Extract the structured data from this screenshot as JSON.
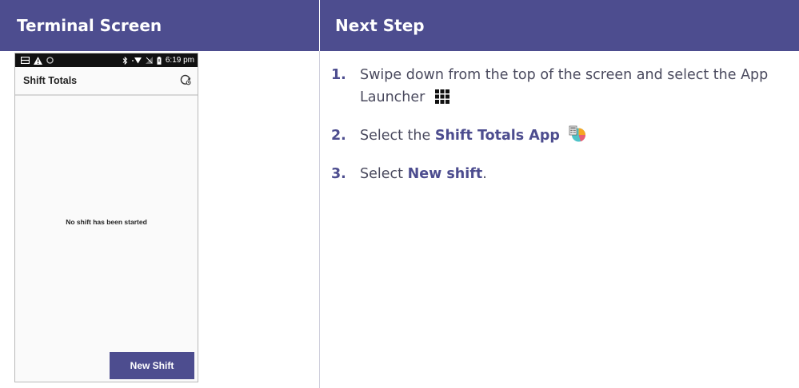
{
  "headers": {
    "left": "Terminal Screen",
    "right": "Next Step"
  },
  "terminal": {
    "status_time": "6:19 pm",
    "app_title": "Shift Totals",
    "empty_message": "No shift has been started",
    "button_label": "New Shift",
    "icons": [
      "message-icon",
      "warning-icon",
      "circle-icon",
      "bluetooth-icon",
      "wifi-icon",
      "signal-icon",
      "battery-icon",
      "history-icon"
    ]
  },
  "steps": [
    {
      "number": "1.",
      "text": "Swipe down from the top of the screen and select the App Launcher",
      "icon": "app-launcher-grid-icon"
    },
    {
      "number": "2.",
      "text_before": "Select the ",
      "bold": "Shift Totals App",
      "icon": "shift-totals-app-icon"
    },
    {
      "number": "3.",
      "text_before": "Select ",
      "bold": "New shift",
      "text_after": "."
    }
  ],
  "colors": {
    "brand": "#4d4d8f",
    "text": "#4a4a5e",
    "status_bar": "#111111"
  }
}
